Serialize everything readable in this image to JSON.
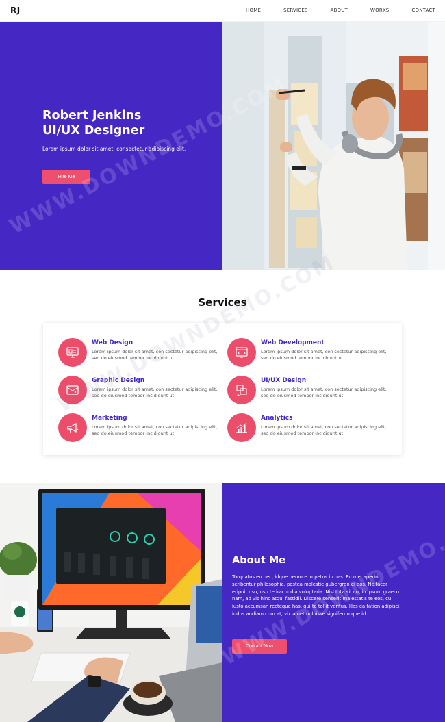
{
  "nav": {
    "logo": "RJ",
    "links": [
      "HOME",
      "SERVICES",
      "ABOUT",
      "WORKS",
      "CONTACT"
    ]
  },
  "hero": {
    "name": "Robert Jenkins",
    "role": "UI/UX Designer",
    "subtitle": "Lorem ipsum dolor sit amet, consectetur adipiscing elit,",
    "button": "Hire Me",
    "bg_color": "#4527c4",
    "button_color": "#ef4f6e"
  },
  "services": {
    "title": "Services",
    "items": [
      {
        "name": "Web Design",
        "desc": "Lorem ipsum dolor sit amet, con sectetur adipiscing elit, sed do eiusmod tempor incididunt ut",
        "icon": "web-design-icon"
      },
      {
        "name": "Web Development",
        "desc": "Lorem ipsum dolor sit amet, con sectetur adipiscing elit, sed do eiusmod tempor incididunt ut",
        "icon": "web-development-icon"
      },
      {
        "name": "Graphic Design",
        "desc": "Lorem ipsum dolor sit amet, con sectetur adipiscing elit, sed do eiusmod tempor incididunt ut",
        "icon": "graphic-design-icon"
      },
      {
        "name": "UI/UX Design",
        "desc": "Lorem ipsum dolor sit amet, con sectetur adipiscing elit, sed do eiusmod tempor incididunt ut",
        "icon": "ui-ux-design-icon"
      },
      {
        "name": "Marketing",
        "desc": "Lorem ipsum dolor sit amet, con sectetur adipiscing elit, sed do eiusmod tempor incididunt ut",
        "icon": "megaphone-icon"
      },
      {
        "name": "Analytics",
        "desc": "Lorem ipsum dolor sit amet, con sectetur adipiscing elit, sed do eiusmod tempor incididunt ut",
        "icon": "analytics-chart-icon"
      }
    ],
    "icon_color": "#ec4d6b",
    "name_color": "#4527c4"
  },
  "about": {
    "title": "About Me",
    "text": "Torquatos eu nec, idque nemore impetus in has. Eu mel aperiri scribentur philosophia, postea molestie gubergren ei eos. Ne facer eripuit usu, usu te iracundia voluptaria. Nisl tota sit cu, in ipsum graeco nam, ad vis hinc atqui fastidii. Discere senserit maiestatis te eos, cu iusto accumsan recteque has, qui te tollit veritus. Has ea tation adipisci, iudus audiam cum at, vix amet noluisse signiferumque id.",
    "button": "Contact Now"
  },
  "watermark": "WWW.DOWNDEMO.COM"
}
